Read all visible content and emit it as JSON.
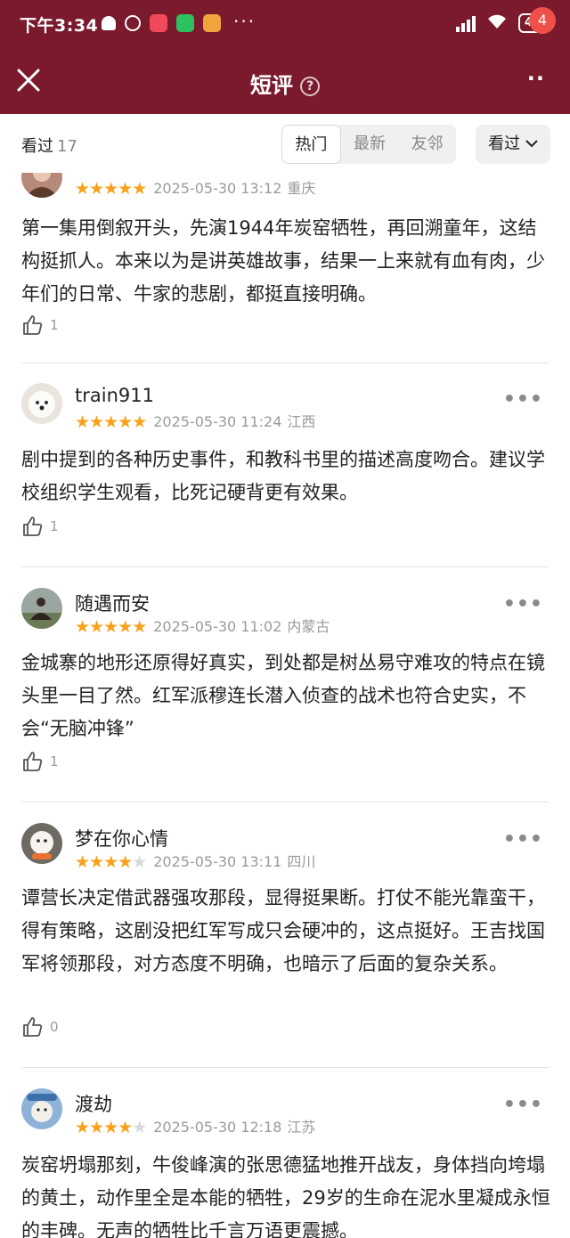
{
  "status_bar": {
    "time": "下午3:34",
    "more": "···",
    "battery": "40"
  },
  "header": {
    "title": "短评",
    "help": "?",
    "menu": "··",
    "badge": "4"
  },
  "filter": {
    "label": "看过",
    "count": "17",
    "segments": [
      "热门",
      "最新",
      "友邻"
    ],
    "active_segment": "热门",
    "dropdown": "看过"
  },
  "reviews": [
    {
      "username": "",
      "rating": 5,
      "date": "2025-05-30 13:12",
      "location": "重庆",
      "text": "第一集用倒叙开头，先演1944年炭窑牺牲，再回溯童年，这结构挺抓人。本来以为是讲英雄故事，结果一上来就有血有肉，少年们的日常、牛家的悲剧，都挺直接明确。",
      "likes": "1"
    },
    {
      "username": "train911",
      "rating": 5,
      "date": "2025-05-30 11:24",
      "location": "江西",
      "text": "剧中提到的各种历史事件，和教科书里的描述高度吻合。建议学校组织学生观看，比死记硬背更有效果。",
      "likes": "1"
    },
    {
      "username": "随遇而安",
      "rating": 5,
      "date": "2025-05-30 11:02",
      "location": "内蒙古",
      "text": "金城寨的地形还原得好真实，到处都是树丛易守难攻的特点在镜头里一目了然。红军派穆连长潜入侦查的战术也符合史实，不会“无脑冲锋”",
      "likes": "1"
    },
    {
      "username": "梦在你心情",
      "rating": 4,
      "date": "2025-05-30 13:11",
      "location": "四川",
      "text": "谭营长决定借武器强攻那段，显得挺果断。打仗不能光靠蛮干，得有策略，这剧没把红军写成只会硬冲的，这点挺好。王吉找国军将领那段，对方态度不明确，也暗示了后面的复杂关系。",
      "likes": "0"
    },
    {
      "username": "渡劫",
      "rating": 4,
      "date": "2025-05-30 12:18",
      "location": "江苏",
      "text": "炭窑坍塌那刻，牛俊峰演的张思德猛地推开战友，身体挡向垮塌的黄土，动作里全是本能的牺牲，29岁的生命在泥水里凝成永恒的丰碑。无声的牺牲比千言万语更震撼。",
      "likes": ""
    }
  ],
  "colors": {
    "header_bg": "#7a1a2c",
    "star": "#f7a21a",
    "badge": "#f0504a"
  }
}
